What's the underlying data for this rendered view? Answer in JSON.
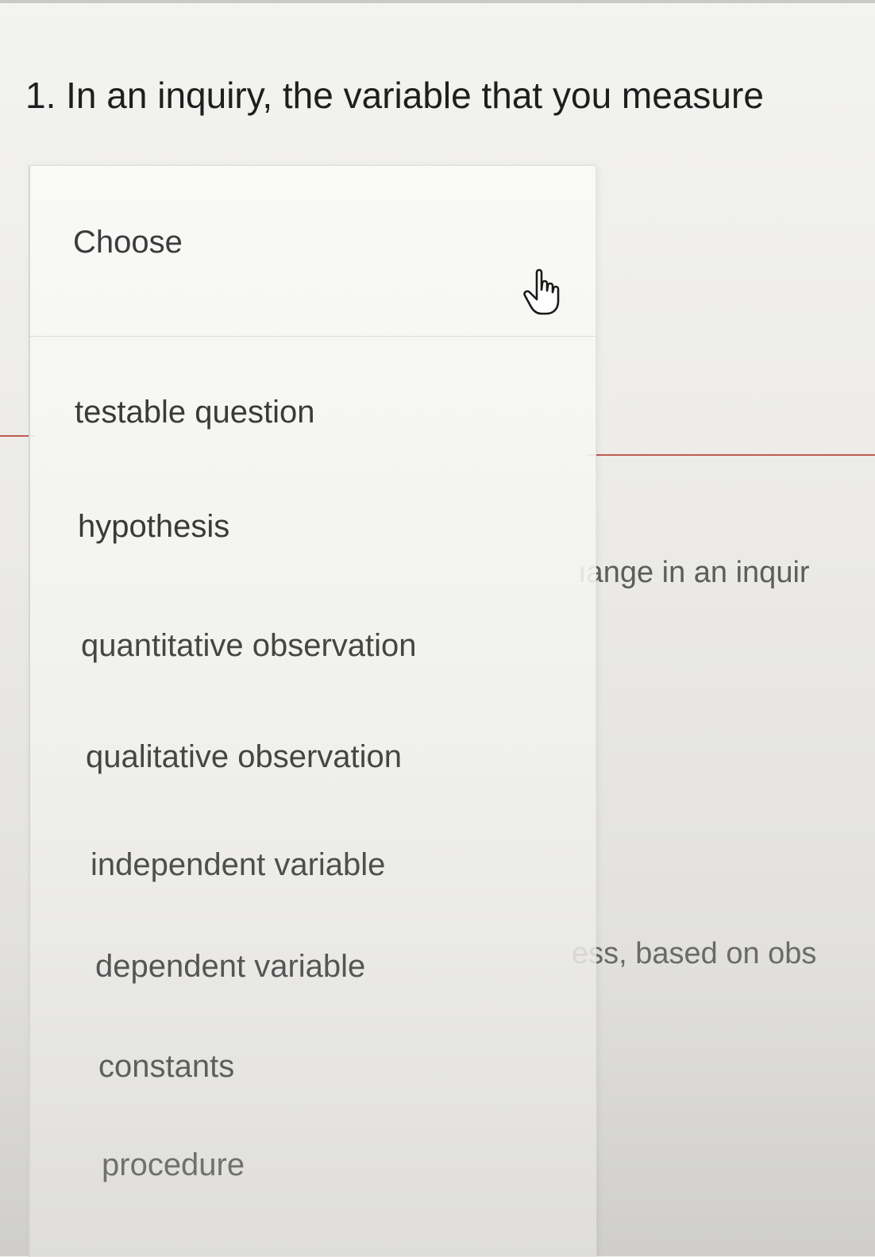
{
  "question": {
    "text": "1. In an inquiry, the variable that you measure"
  },
  "background": {
    "partial_text_1": "ıange in an inquir",
    "partial_text_2": "ess, based on obs"
  },
  "dropdown": {
    "selected_label": "Choose",
    "options": [
      "testable question",
      "hypothesis",
      "quantitative observation",
      "qualitative observation",
      "independent variable",
      "dependent variable",
      "constants",
      "procedure"
    ]
  },
  "colors": {
    "underline_accent": "#c05a50",
    "menu_bg": "#f5f5f3"
  },
  "icons": {
    "cursor": "pointer-hand-icon"
  }
}
